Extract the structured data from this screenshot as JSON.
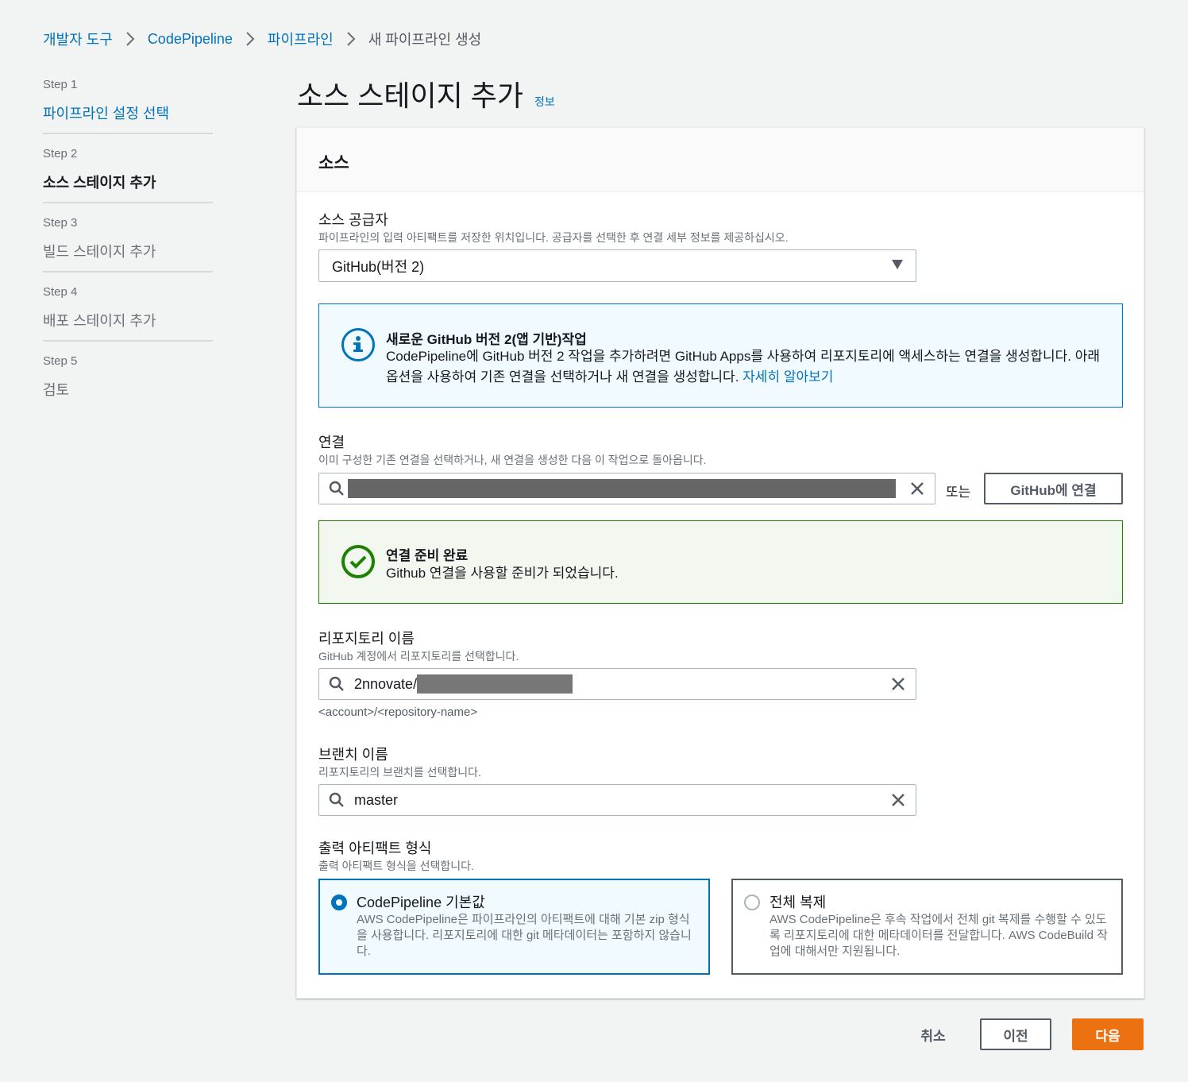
{
  "breadcrumb": {
    "items": [
      "개발자 도구",
      "CodePipeline",
      "파이프라인"
    ],
    "current": "새 파이프라인 생성"
  },
  "steps": [
    {
      "num": "Step 1",
      "title": "파이프라인 설정 선택"
    },
    {
      "num": "Step 2",
      "title": "소스 스테이지 추가"
    },
    {
      "num": "Step 3",
      "title": "빌드 스테이지 추가"
    },
    {
      "num": "Step 4",
      "title": "배포 스테이지 추가"
    },
    {
      "num": "Step 5",
      "title": "검토"
    }
  ],
  "page": {
    "title": "소스 스테이지 추가",
    "info": "정보"
  },
  "panel": {
    "title": "소스"
  },
  "provider": {
    "label": "소스 공급자",
    "desc": "파이프라인의 입력 아티팩트를 저장한 위치입니다. 공급자를 선택한 후 연결 세부 정보를 제공하십시오.",
    "value": "GitHub(버전 2)"
  },
  "info_alert": {
    "title": "새로운 GitHub 버전 2(앱 기반)작업",
    "text": "CodePipeline에 GitHub 버전 2 작업을 추가하려면 GitHub Apps를 사용하여 리포지토리에 액세스하는 연결을 생성합니다. 아래 옵션을 사용하여 기존 연결을 선택하거나 새 연결을 생성합니다.",
    "link": "자세히 알아보기"
  },
  "connection": {
    "label": "연결",
    "desc": "이미 구성한 기존 연결을 선택하거나, 새 연결을 생성한 다음 이 작업으로 돌아옵니다.",
    "or": "또는",
    "connect_button": "GitHub에 연결"
  },
  "success_alert": {
    "title": "연결 준비 완료",
    "text": "Github 연결을 사용할 준비가 되었습니다."
  },
  "repository": {
    "label": "리포지토리 이름",
    "desc": "GitHub 계정에서 리포지토리를 선택합니다.",
    "value": "2nnovate/",
    "hint": "<account>/<repository-name>"
  },
  "branch": {
    "label": "브랜치 이름",
    "desc": "리포지토리의 브랜치를 선택합니다.",
    "value": "master"
  },
  "artifact": {
    "label": "출력 아티팩트 형식",
    "desc": "출력 아티팩트 형식을 선택합니다.",
    "options": [
      {
        "title": "CodePipeline 기본값",
        "desc": "AWS CodePipeline은 파이프라인의 아티팩트에 대해 기본 zip 형식을 사용합니다. 리포지토리에 대한 git 메타데이터는 포함하지 않습니다."
      },
      {
        "title": "전체 복제",
        "desc": "AWS CodePipeline은 후속 작업에서 전체 git 복제를 수행할 수 있도록 리포지토리에 대한 메타데이터를 전달합니다. AWS CodeBuild 작업에 대해서만 지원됩니다."
      }
    ]
  },
  "footer": {
    "cancel": "취소",
    "previous": "이전",
    "next": "다음"
  },
  "colors": {
    "link": "#0073bb",
    "primary": "#ec7211",
    "success": "#1d8102"
  }
}
